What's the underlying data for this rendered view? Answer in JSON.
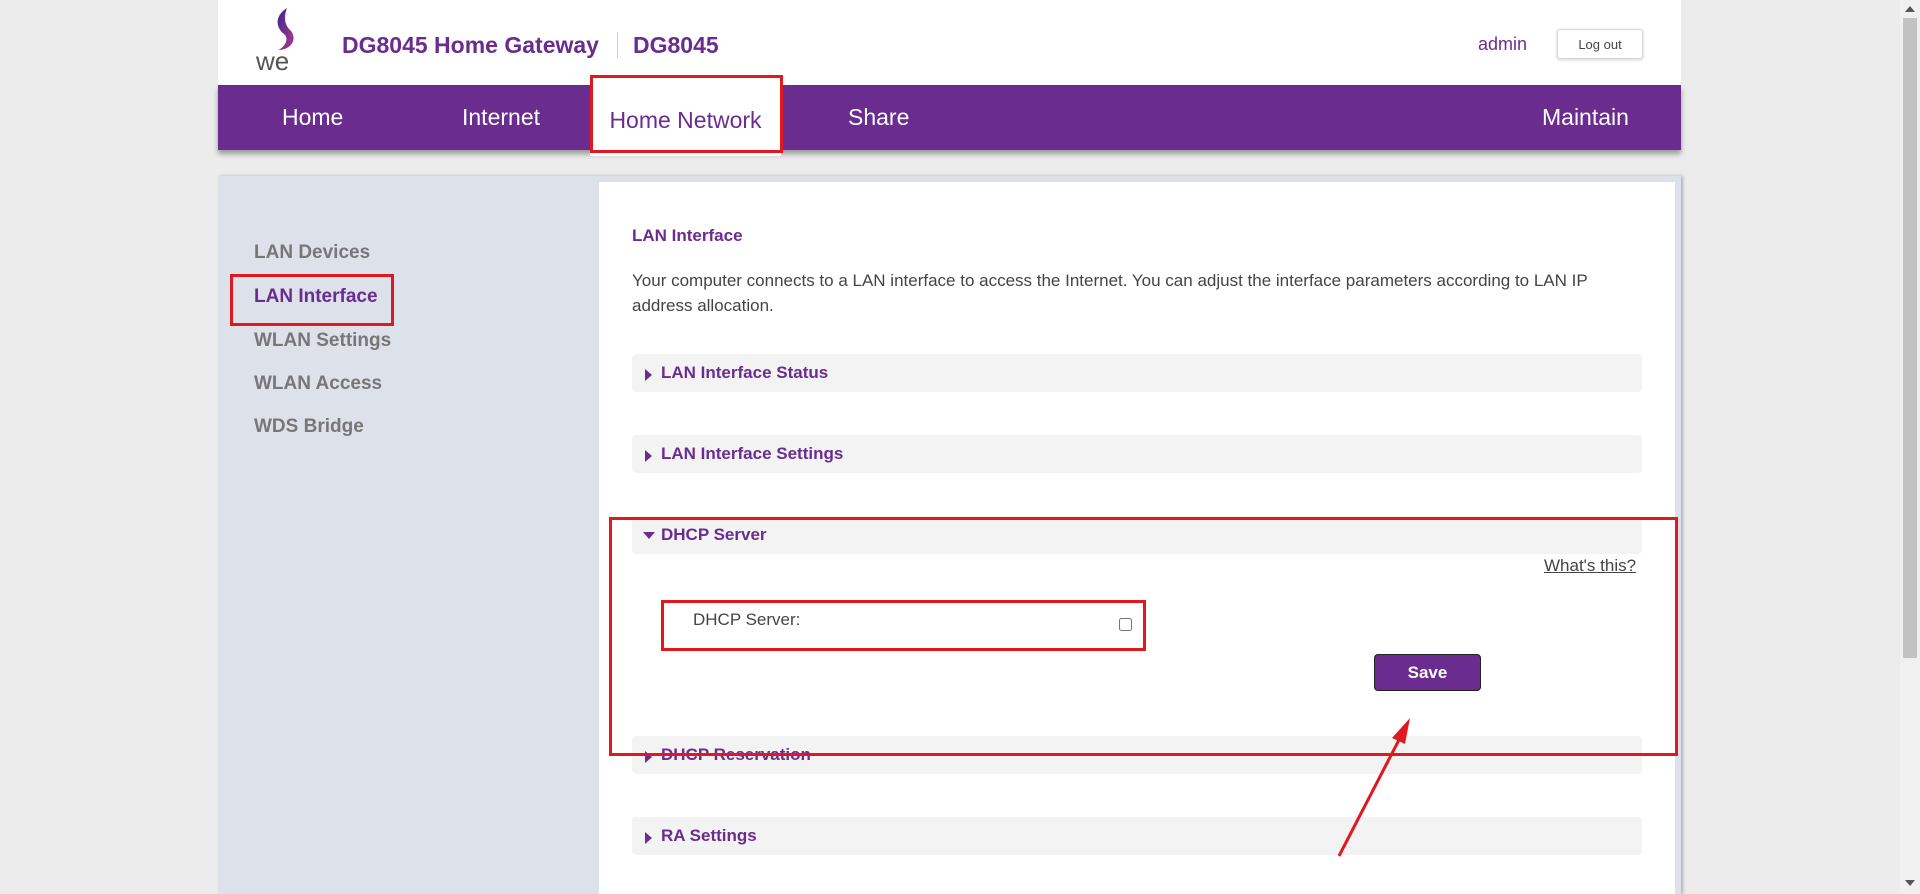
{
  "header": {
    "title": "DG8045 Home Gateway",
    "model": "DG8045",
    "user": "admin",
    "logout_label": "Log out",
    "brand_color": "#6a2c8f"
  },
  "nav": {
    "items": [
      {
        "label": "Home"
      },
      {
        "label": "Internet"
      },
      {
        "label": "Home Network",
        "active": true
      },
      {
        "label": "Share"
      },
      {
        "label": "Maintain"
      }
    ]
  },
  "sidebar": {
    "items": [
      {
        "label": "LAN Devices"
      },
      {
        "label": "LAN Interface",
        "active": true
      },
      {
        "label": "WLAN Settings"
      },
      {
        "label": "WLAN Access"
      },
      {
        "label": "WDS Bridge"
      }
    ]
  },
  "main": {
    "title": "LAN Interface",
    "description": "Your computer connects to a LAN interface to access the Internet. You can adjust the interface parameters according to LAN IP address allocation.",
    "sections": [
      {
        "label": "LAN Interface Status",
        "expanded": false
      },
      {
        "label": "LAN Interface Settings",
        "expanded": false
      },
      {
        "label": "DHCP Server",
        "expanded": true
      },
      {
        "label": "DHCP Reservation",
        "expanded": false
      },
      {
        "label": "RA Settings",
        "expanded": false
      }
    ],
    "dhcp": {
      "whats_this": "What's this?",
      "field_label": "DHCP Server:",
      "enabled": false,
      "save_label": "Save"
    }
  },
  "annotation_color": "#e0181f"
}
